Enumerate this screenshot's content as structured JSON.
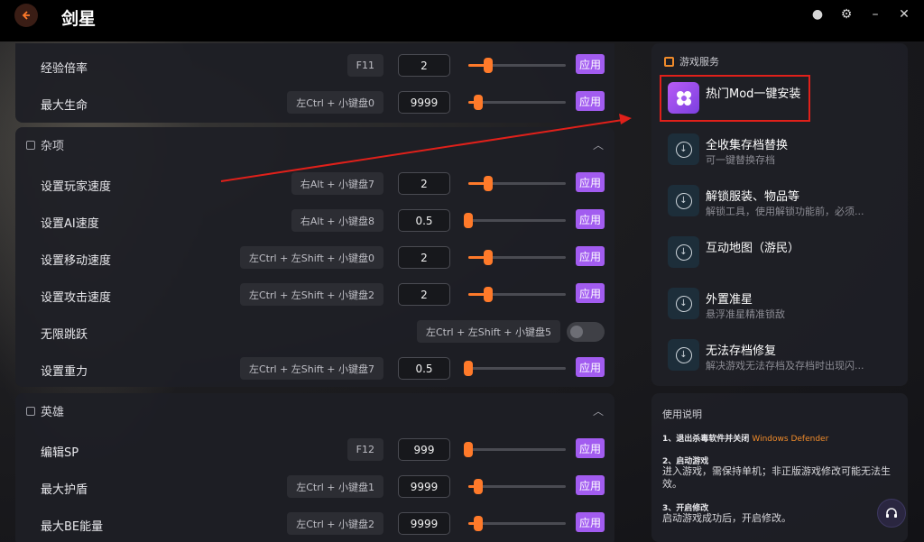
{
  "app": {
    "title": "剑星"
  },
  "top_rows": [
    {
      "label": "经验倍率",
      "hotkey": "F11",
      "value": "2",
      "level": 0.2,
      "apply": "应用"
    },
    {
      "label": "最大生命",
      "hotkey": "左Ctrl + 小键盘0",
      "value": "9999",
      "level": 0.1,
      "apply": "应用"
    }
  ],
  "misc": {
    "title": "杂项",
    "rows": [
      {
        "label": "设置玩家速度",
        "hotkey": "右Alt + 小键盘7",
        "value": "2",
        "level": 0.2,
        "apply": "应用"
      },
      {
        "label": "设置AI速度",
        "hotkey": "右Alt + 小键盘8",
        "value": "0.5",
        "level": 0.0,
        "apply": "应用"
      },
      {
        "label": "设置移动速度",
        "hotkey": "左Ctrl + 左Shift + 小键盘0",
        "value": "2",
        "level": 0.2,
        "apply": "应用"
      },
      {
        "label": "设置攻击速度",
        "hotkey": "左Ctrl + 左Shift + 小键盘2",
        "value": "2",
        "level": 0.2,
        "apply": "应用"
      },
      {
        "label": "无限跳跃",
        "hotkey": "左Ctrl + 左Shift + 小键盘5",
        "toggle": false
      },
      {
        "label": "设置重力",
        "hotkey": "左Ctrl + 左Shift + 小键盘7",
        "value": "0.5",
        "level": 0.0,
        "apply": "应用"
      }
    ]
  },
  "hero": {
    "title": "英雄",
    "rows": [
      {
        "label": "编辑SP",
        "hotkey": "F12",
        "value": "999",
        "level": 0.0,
        "apply": "应用"
      },
      {
        "label": "最大护盾",
        "hotkey": "左Ctrl + 小键盘1",
        "value": "9999",
        "level": 0.1,
        "apply": "应用"
      },
      {
        "label": "最大BE能量",
        "hotkey": "左Ctrl + 小键盘2",
        "value": "9999",
        "level": 0.1,
        "apply": "应用"
      }
    ]
  },
  "services": {
    "title": "游戏服务",
    "items": [
      {
        "title": "热门Mod一键安装",
        "subtitle": ""
      },
      {
        "title": "全收集存档替换",
        "subtitle": "可一键替换存档"
      },
      {
        "title": "解锁服装、物品等",
        "subtitle": "解锁工具，使用解锁功能前，必须..."
      },
      {
        "title": "互动地图（游民）",
        "subtitle": ""
      },
      {
        "title": "外置准星",
        "subtitle": "悬浮准星精准锁敌"
      },
      {
        "title": "无法存档修复",
        "subtitle": "解决游戏无法存档及存档时出现闪..."
      }
    ]
  },
  "help": {
    "title": "使用说明",
    "step1": "1、退出杀毒软件并关闭",
    "step1_highlight": "Windows Defender",
    "step2": "2、启动游戏",
    "step2_text": "进入游戏，需保持单机；非正版游戏修改可能无法生效。",
    "step3": "3、开启修改",
    "step3_text": "启动游戏成功后，开启修改。"
  },
  "colors": {
    "accent": "#a25cf0",
    "slider": "#ff7a2a",
    "highlight_box": "#e0201a"
  }
}
